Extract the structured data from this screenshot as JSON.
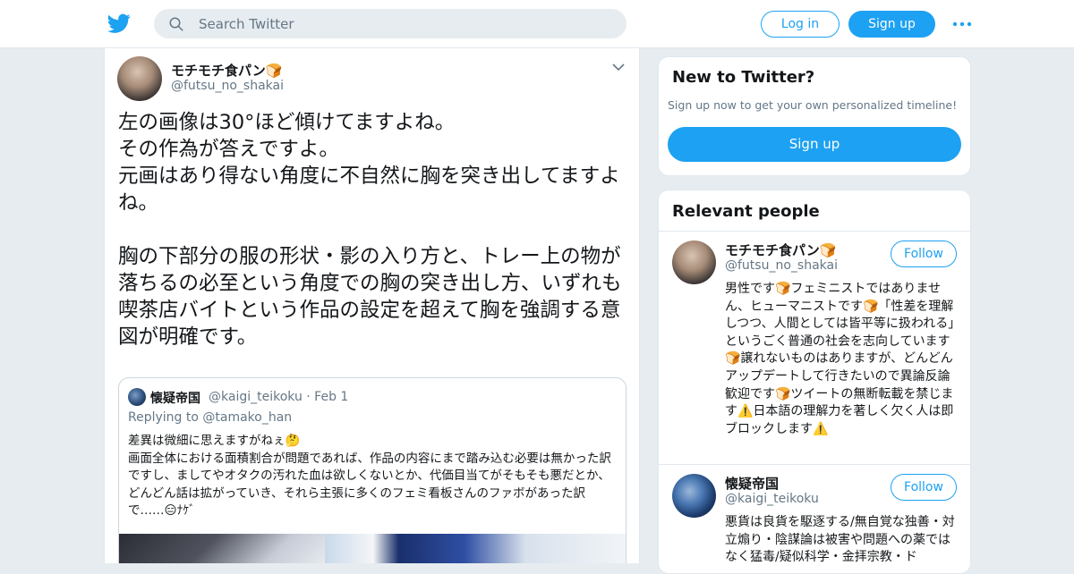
{
  "header": {
    "search_placeholder": "Search Twitter",
    "login_label": "Log in",
    "signup_label": "Sign up"
  },
  "tweet": {
    "display_name": "モチモチ食パン🍞",
    "handle": "@futsu_no_shakai",
    "text": "左の画像は30°ほど傾けてますよね。\nその作為が答えですよ。\n元画はあり得ない角度に不自然に胸を突き出してますよね。\n\n胸の下部分の服の形状・影の入り方と、トレー上の物が落ちるの必至という角度での胸の突き出し方、いずれも喫茶店バイトという作品の設定を超えて胸を強調する意図が明確です。",
    "quote": {
      "display_name": "懐疑帝国",
      "handle_date": "@kaigi_teikoku · Feb 1",
      "reply_to": "Replying to @tamako_han",
      "text": "差異は微細に思えますがねぇ🤔\n画面全体における面積割合が問題であれば、作品の内容にまで踏み込む必要は無かった訳ですし、ましてやオタクの汚れた血は欲しくないとか、代価目当てがそもそも悪だとか、どんどん話は拡がっていき、それら主張に多くのフェミ看板さんのファボがあった訳で……😑ﾅｹﾞ"
    }
  },
  "new_to_twitter": {
    "title": "New to Twitter?",
    "subtitle": "Sign up now to get your own personalized timeline!",
    "signup_label": "Sign up"
  },
  "relevant_people": {
    "title": "Relevant people",
    "people": [
      {
        "display_name": "モチモチ食パン🍞",
        "handle": "@futsu_no_shakai",
        "follow_label": "Follow",
        "bio": "男性です🍞フェミニストではありません、ヒューマニストです🍞「性差を理解しつつ、人間としては皆平等に扱われる」というごく普通の社会を志向しています🍞譲れないものはありますが、どんどんアップデートして行きたいので異論反論歓迎です🍞ツイートの無断転載を禁じます⚠️日本語の理解力を著しく欠く人は即ブロックします⚠️"
      },
      {
        "display_name": "懐疑帝国",
        "handle": "@kaigi_teikoku",
        "follow_label": "Follow",
        "bio": "悪貨は良貨を駆逐する/無自覚な独善・対立煽り・陰謀論は被害や問題への薬ではなく猛毒/疑似科学・金拝宗教・ド"
      }
    ]
  },
  "colors": {
    "accent": "#1da1f2",
    "background": "#e6ecf0",
    "muted_text": "#657786",
    "border": "#e1e8ed"
  }
}
